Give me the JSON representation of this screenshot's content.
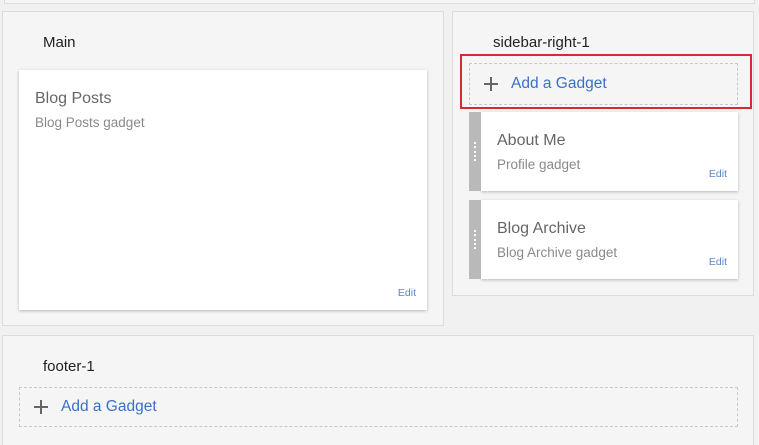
{
  "main": {
    "title": "Main",
    "gadgets": [
      {
        "title": "Blog Posts",
        "subtitle": "Blog Posts gadget",
        "edit_label": "Edit"
      }
    ]
  },
  "sidebar": {
    "title": "sidebar-right-1",
    "add_gadget_label": "Add a Gadget",
    "gadgets": [
      {
        "title": "About Me",
        "subtitle": "Profile gadget",
        "edit_label": "Edit"
      },
      {
        "title": "Blog Archive",
        "subtitle": "Blog Archive gadget",
        "edit_label": "Edit"
      }
    ]
  },
  "footer": {
    "title": "footer-1",
    "add_gadget_label": "Add a Gadget"
  },
  "colors": {
    "link": "#3b6fc6",
    "highlight": "#d9282f",
    "handle": "#b9b9b9"
  }
}
